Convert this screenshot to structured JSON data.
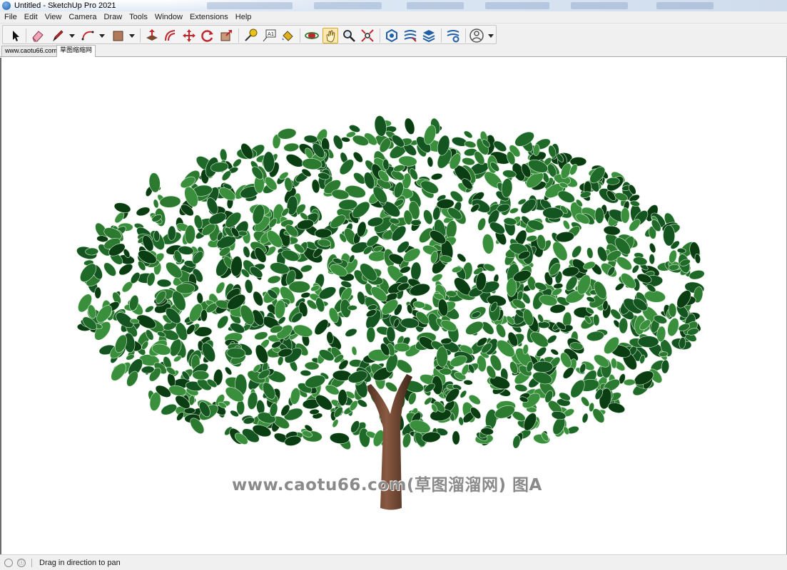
{
  "window": {
    "title": "Untitled - SketchUp Pro 2021"
  },
  "menu": {
    "items": [
      "File",
      "Edit",
      "View",
      "Camera",
      "Draw",
      "Tools",
      "Window",
      "Extensions",
      "Help"
    ]
  },
  "toolbar": {
    "tools": [
      {
        "name": "select",
        "icon": "arrow-cursor-icon"
      },
      {
        "name": "eraser",
        "icon": "eraser-icon"
      },
      {
        "name": "line",
        "icon": "pencil-icon"
      },
      {
        "name": "arc",
        "icon": "arc-icon"
      },
      {
        "name": "rectangle",
        "icon": "rectangle-icon"
      },
      {
        "name": "push-pull",
        "icon": "push-pull-icon"
      },
      {
        "name": "offset",
        "icon": "offset-icon"
      },
      {
        "name": "move",
        "icon": "move-icon"
      },
      {
        "name": "rotate",
        "icon": "rotate-icon"
      },
      {
        "name": "scale",
        "icon": "scale-icon"
      },
      {
        "name": "tape-measure",
        "icon": "tape-measure-icon"
      },
      {
        "name": "text",
        "icon": "text-icon"
      },
      {
        "name": "paint-bucket",
        "icon": "paint-bucket-icon"
      },
      {
        "name": "orbit",
        "icon": "orbit-icon"
      },
      {
        "name": "pan",
        "icon": "pan-hand-icon"
      },
      {
        "name": "zoom",
        "icon": "zoom-icon"
      },
      {
        "name": "zoom-extents",
        "icon": "zoom-extents-icon"
      },
      {
        "name": "3d-warehouse",
        "icon": "warehouse-icon"
      },
      {
        "name": "extension-warehouse",
        "icon": "extension-warehouse-icon"
      },
      {
        "name": "layout",
        "icon": "layout-icon"
      },
      {
        "name": "extension-manager",
        "icon": "extension-manager-icon"
      },
      {
        "name": "account",
        "icon": "user-account-icon"
      }
    ],
    "active_tool": "pan"
  },
  "scene_tabs": [
    "www.caotu66.com",
    "草图缩缩网"
  ],
  "viewport": {
    "watermark": "www.caotu66.com(草图溜溜网) 图A"
  },
  "status": {
    "message": "Drag in direction to pan",
    "info_icon": "ⓘ"
  },
  "colors": {
    "foliage_dark": "#0b3d12",
    "foliage_mid": "#1f6a28",
    "foliage_light": "#3a8f3c",
    "trunk": "#6e4632",
    "active_tool_bg": "#fbe9b0"
  }
}
